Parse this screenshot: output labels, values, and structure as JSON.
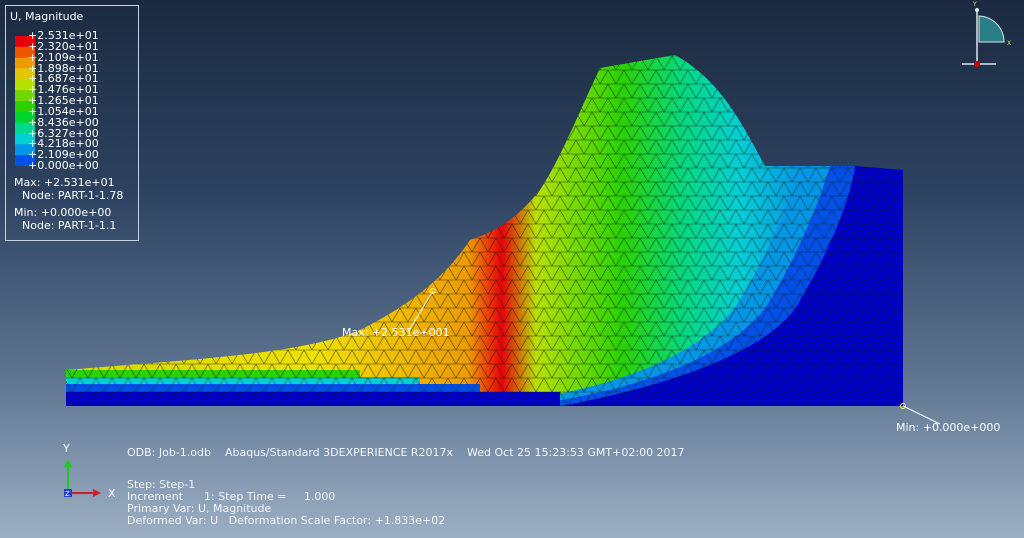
{
  "legend": {
    "title": "U, Magnitude",
    "values": [
      "+2.531e+01",
      "+2.320e+01",
      "+2.109e+01",
      "+1.898e+01",
      "+1.687e+01",
      "+1.476e+01",
      "+1.265e+01",
      "+1.054e+01",
      "+8.436e+00",
      "+6.327e+00",
      "+4.218e+00",
      "+2.109e+00",
      "+0.000e+00"
    ],
    "colors": [
      "#e8000a",
      "#ec5400",
      "#ee9b00",
      "#e0c800",
      "#b8e000",
      "#6fd800",
      "#2ad200",
      "#00d52b",
      "#00d98a",
      "#00cfd4",
      "#0097e6",
      "#0050ea",
      "#0000c8"
    ],
    "max_line": "Max: +2.531e+01",
    "max_node": "Node: PART-1-1.78",
    "min_line": "Min: +0.000e+00",
    "min_node": "Node: PART-1-1.1"
  },
  "annotations": {
    "max_label": "Max: +2.531e+001",
    "min_label": "Min: +0.000e+000"
  },
  "triad": {
    "y_label": "Y",
    "x_label": "X",
    "z_label": "Z"
  },
  "info": {
    "odb_line": "ODB: Job-1.odb    Abaqus/Standard 3DEXPERIENCE R2017x    Wed Oct 25 15:23:53 GMT+02:00 2017",
    "step_line": "Step: Step-1",
    "increment_line": "Increment      1: Step Time =     1.000",
    "primary_line": "Primary Var: U, Magnitude",
    "deformed_line": "Deformed Var: U   Deformation Scale Factor: +1.833e+02"
  },
  "view_cube": {
    "y_label": "Y",
    "x_label": "X"
  }
}
